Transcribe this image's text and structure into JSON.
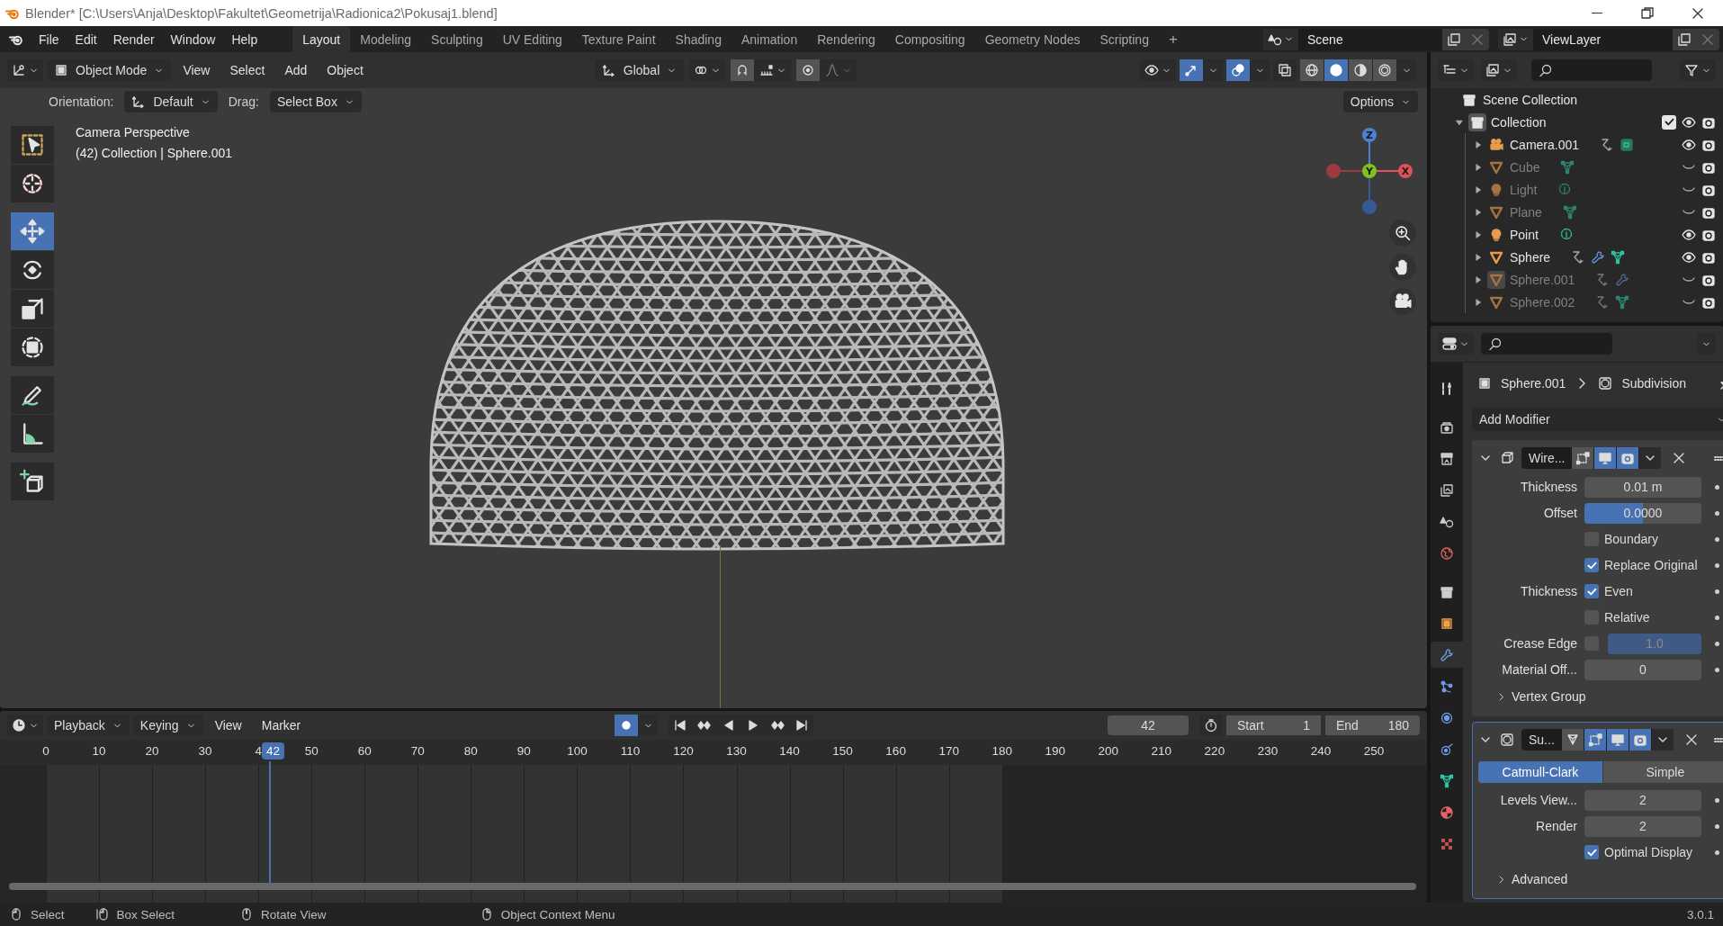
{
  "window": {
    "title": "Blender* [C:\\Users\\Anja\\Desktop\\Fakultet\\Geometrija\\Radionica2\\Pokusaj1.blend]"
  },
  "menu": [
    "File",
    "Edit",
    "Render",
    "Window",
    "Help"
  ],
  "workspaces": [
    {
      "label": "Layout",
      "selected": true
    },
    {
      "label": "Modeling",
      "selected": false
    },
    {
      "label": "Sculpting",
      "selected": false
    },
    {
      "label": "UV Editing",
      "selected": false
    },
    {
      "label": "Texture Paint",
      "selected": false
    },
    {
      "label": "Shading",
      "selected": false
    },
    {
      "label": "Animation",
      "selected": false
    },
    {
      "label": "Rendering",
      "selected": false
    },
    {
      "label": "Compositing",
      "selected": false
    },
    {
      "label": "Geometry Nodes",
      "selected": false
    },
    {
      "label": "Scripting",
      "selected": false
    }
  ],
  "add_workspace": "+",
  "scene": {
    "name": "Scene"
  },
  "view_layer": {
    "name": "ViewLayer"
  },
  "viewport": {
    "mode": "Object Mode",
    "menus": [
      "View",
      "Select",
      "Add",
      "Object"
    ],
    "transform_orientation": "Global",
    "header_toggles": [
      {
        "kind": "gizmo",
        "on": true
      },
      {
        "kind": "overlay",
        "on": true
      },
      {
        "kind": "xray",
        "on": false
      }
    ],
    "shading": [
      {
        "kind": "wireframe",
        "selected": false
      },
      {
        "kind": "solid",
        "selected": true
      },
      {
        "kind": "material",
        "selected": false
      },
      {
        "kind": "rendered",
        "selected": false
      }
    ],
    "orientation_label": "Orientation:",
    "orientation": "Default",
    "drag_label": "Drag:",
    "drag": "Select Box",
    "options": "Options",
    "info": [
      "Camera Perspective",
      "(42) Collection | Sphere.001"
    ],
    "tools": [
      {
        "kind": "select-box",
        "selected": false
      },
      {
        "kind": "cursor",
        "selected": false
      },
      {
        "kind": "move",
        "selected": true
      },
      {
        "kind": "rotate",
        "selected": false
      },
      {
        "kind": "scale",
        "selected": false
      },
      {
        "kind": "transform",
        "selected": false
      },
      {
        "kind": "annotate",
        "selected": false
      },
      {
        "kind": "measure",
        "selected": false
      },
      {
        "kind": "add-cube",
        "selected": false
      }
    ],
    "gizmo_axes": [
      "Z",
      "Y",
      "X"
    ]
  },
  "outliner": {
    "root": "Scene Collection",
    "collection": {
      "name": "Collection",
      "expanded": true,
      "checked": true,
      "visible": true,
      "children": [
        {
          "name": "Camera.001",
          "kind": "camera",
          "expanded": false,
          "visible": true,
          "selected": false,
          "extras": [
            {
              "kind": "constraint"
            },
            {
              "kind": "camera-data"
            }
          ]
        },
        {
          "name": "Cube",
          "kind": "mesh",
          "expanded": false,
          "visible": false,
          "selected": false,
          "extras": [
            {
              "kind": "mesh-data"
            }
          ]
        },
        {
          "name": "Light",
          "kind": "light",
          "expanded": false,
          "visible": false,
          "selected": false,
          "extras": [
            {
              "kind": "light-data"
            }
          ]
        },
        {
          "name": "Plane",
          "kind": "mesh",
          "expanded": false,
          "visible": false,
          "selected": false,
          "extras": [
            {
              "kind": "mesh-data"
            }
          ]
        },
        {
          "name": "Point",
          "kind": "light",
          "expanded": false,
          "visible": true,
          "selected": false,
          "extras": [
            {
              "kind": "light-data"
            }
          ]
        },
        {
          "name": "Sphere",
          "kind": "mesh",
          "expanded": false,
          "visible": true,
          "selected": false,
          "extras": [
            {
              "kind": "constraint"
            },
            {
              "kind": "modifier"
            },
            {
              "kind": "mesh-data"
            }
          ]
        },
        {
          "name": "Sphere.001",
          "kind": "mesh",
          "expanded": false,
          "visible": false,
          "selected": true,
          "extras": [
            {
              "kind": "constraint"
            },
            {
              "kind": "modifier"
            }
          ]
        },
        {
          "name": "Sphere.002",
          "kind": "mesh",
          "expanded": false,
          "visible": false,
          "selected": false,
          "extras": [
            {
              "kind": "constraint"
            },
            {
              "kind": "mesh-data"
            }
          ]
        }
      ]
    }
  },
  "properties": {
    "tabs": [
      {
        "kind": "tool",
        "selected": false
      },
      {
        "kind": "render",
        "selected": false
      },
      {
        "kind": "output",
        "selected": false
      },
      {
        "kind": "view-layer",
        "selected": false
      },
      {
        "kind": "scene",
        "selected": false
      },
      {
        "kind": "world",
        "selected": false
      },
      {
        "kind": "collection",
        "selected": false
      },
      {
        "kind": "object",
        "selected": false
      },
      {
        "kind": "modifier",
        "selected": true
      },
      {
        "kind": "particles",
        "selected": false
      },
      {
        "kind": "physics",
        "selected": false
      },
      {
        "kind": "constraints",
        "selected": false
      },
      {
        "kind": "data",
        "selected": false
      },
      {
        "kind": "material",
        "selected": false
      },
      {
        "kind": "texture",
        "selected": false
      }
    ],
    "object": "Sphere.001",
    "context": "Subdivision",
    "add_modifier": "Add Modifier",
    "modifiers": [
      {
        "kind": "wireframe",
        "name": "Wire...",
        "expanded": true,
        "active": false,
        "toggles": [
          {
            "kind": "edit-mode",
            "on": false
          },
          {
            "kind": "viewport",
            "on": true
          },
          {
            "kind": "render",
            "on": true
          }
        ],
        "rows": [
          {
            "kind": "number",
            "label": "Thickness",
            "value": "0.01 m"
          },
          {
            "kind": "slider",
            "label": "Offset",
            "value": "0.0000",
            "level": 0.5
          },
          {
            "kind": "checkbox",
            "label": "Boundary",
            "checked": false
          },
          {
            "kind": "checkbox",
            "label": "Replace Original",
            "checked": true
          },
          {
            "kind": "checkbox",
            "heading": "Thickness",
            "label": "Even",
            "checked": true
          },
          {
            "kind": "checkbox",
            "label": "Relative",
            "checked": false
          },
          {
            "kind": "check-slider",
            "label": "Crease Edge",
            "checked": false,
            "value": "1.0",
            "level": 1
          },
          {
            "kind": "number",
            "label": "Material Off...",
            "value": "0"
          }
        ],
        "subpanels": [
          {
            "label": "Vertex Group",
            "expanded": false
          }
        ]
      },
      {
        "kind": "subdivision",
        "name": "Su...",
        "expanded": true,
        "active": true,
        "toggles": [
          {
            "kind": "on-cage",
            "on": false
          },
          {
            "kind": "edit-mode",
            "on": true
          },
          {
            "kind": "viewport",
            "on": true
          },
          {
            "kind": "render",
            "on": true
          }
        ],
        "rows": [
          {
            "kind": "segmented",
            "options": [
              {
                "label": "Catmull-Clark",
                "selected": true
              },
              {
                "label": "Simple",
                "selected": false
              }
            ]
          },
          {
            "kind": "number",
            "label": "Levels View...",
            "value": "2"
          },
          {
            "kind": "number",
            "label": "Render",
            "value": "2"
          },
          {
            "kind": "checkbox",
            "label": "Optimal Display",
            "checked": true
          }
        ],
        "subpanels": [
          {
            "label": "Advanced",
            "expanded": false
          }
        ]
      }
    ]
  },
  "timeline": {
    "menus": [
      "Playback",
      "Keying",
      "View",
      "Marker"
    ],
    "auto_keying": true,
    "current_frame": "42",
    "playhead_label": "42",
    "start_label": "Start",
    "start": "1",
    "end_label": "End",
    "end": "180",
    "ticks": [
      "0",
      "10",
      "20",
      "30",
      "4",
      "50",
      "60",
      "70",
      "80",
      "90",
      "100",
      "110",
      "120",
      "130",
      "140",
      "150",
      "160",
      "170",
      "180",
      "190",
      "200",
      "210",
      "220",
      "230",
      "240",
      "250"
    ]
  },
  "status_bar": {
    "items": [
      {
        "kind": "mouse-left",
        "label": "Select"
      },
      {
        "kind": "mouse-drag",
        "label": "Box Select"
      },
      {
        "kind": "mouse-middle",
        "label": "Rotate View"
      },
      {
        "kind": "mouse-right",
        "label": "Object Context Menu"
      }
    ],
    "version": "3.0.1"
  }
}
